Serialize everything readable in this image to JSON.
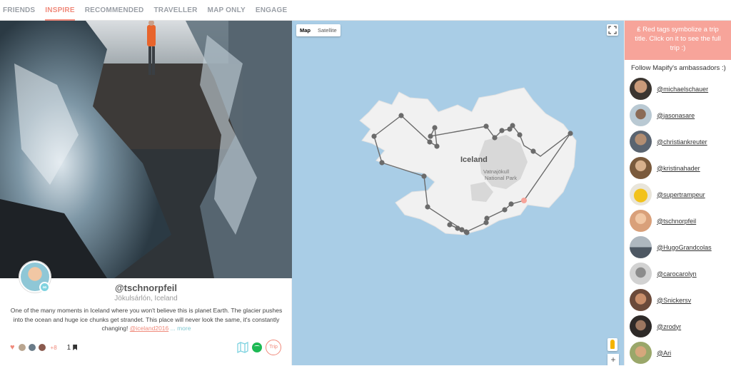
{
  "nav": {
    "tabs": [
      {
        "label": "FRIENDS",
        "active": false
      },
      {
        "label": "INSPIRE",
        "active": true
      },
      {
        "label": "RECOMMENDED",
        "active": false
      },
      {
        "label": "TRAVELLER",
        "active": false
      },
      {
        "label": "MAP ONLY",
        "active": false
      },
      {
        "label": "ENGAGE",
        "active": false
      }
    ]
  },
  "post": {
    "username": "@tschnorpfeil",
    "location": "Jökulsárlón, Iceland",
    "caption": "One of the many moments in Iceland where you won't believe this is planet Earth. The glacier pushes into the ocean and huge ice chunks get strandet. This place will never look the same, it's constantly changing!",
    "hashtag": "@iceland2016",
    "more": "... more",
    "likes_extra": "+8",
    "saves": "1",
    "trip_label": "Trip"
  },
  "map": {
    "map_label": "Map",
    "satellite_label": "Satellite",
    "country_label": "Iceland",
    "park_label_1": "Vatnajökull",
    "park_label_2": "National Park",
    "zoom_in": "+"
  },
  "sidebar": {
    "info": "Red tags symbolize a trip title. Click on it to see the full trip :)",
    "follow_title": "Follow Mapify's ambassadors :)",
    "ambassadors": [
      "@michaelschauer",
      "@jasonasare",
      "@christiankreuter",
      "@kristinahader",
      "@supertrampeur",
      "@tschnorpfeil",
      "@HugoGrandcolas",
      "@carocarolyn",
      "@Snickersv",
      "@zrodyr",
      "@Ari"
    ]
  },
  "colors": {
    "accent": "#f08a7b",
    "info_bg": "#f7a49a",
    "ocean": "#a9cde6",
    "route": "#666666"
  }
}
